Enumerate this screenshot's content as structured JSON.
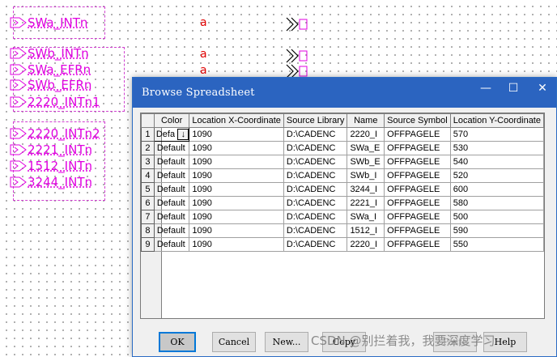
{
  "schematic": {
    "ports": [
      {
        "label": "SWa_INTn"
      },
      {
        "label": "SWb_INTn"
      },
      {
        "label": "SWa_EFRn"
      },
      {
        "label": "SWb_EFRn"
      },
      {
        "label": "2220_INTn1"
      },
      {
        "label": "2220_INTn2"
      },
      {
        "label": "2221_INTn"
      },
      {
        "label": "1512_INTn"
      },
      {
        "label": "3244_INTn"
      }
    ],
    "net_marker": "a"
  },
  "dialog": {
    "title": "Browse Spreadsheet",
    "controls": {
      "minimize": "—",
      "maximize": "☐",
      "close": "✕"
    },
    "columns": [
      "Color",
      "Location X-Coordinate",
      "Source Library",
      "Name",
      "Source Symbol",
      "Location Y-Coordinate"
    ],
    "rows": [
      {
        "num": "1",
        "color": "Defa",
        "x": "1090",
        "lib": "D:\\CADENC",
        "name": "2220_I",
        "symbol": "OFFPAGELE",
        "y": "570"
      },
      {
        "num": "2",
        "color": "Default",
        "x": "1090",
        "lib": "D:\\CADENC",
        "name": "SWa_E",
        "symbol": "OFFPAGELE",
        "y": "530"
      },
      {
        "num": "3",
        "color": "Default",
        "x": "1090",
        "lib": "D:\\CADENC",
        "name": "SWb_E",
        "symbol": "OFFPAGELE",
        "y": "540"
      },
      {
        "num": "4",
        "color": "Default",
        "x": "1090",
        "lib": "D:\\CADENC",
        "name": "SWb_I",
        "symbol": "OFFPAGELE",
        "y": "520"
      },
      {
        "num": "5",
        "color": "Default",
        "x": "1090",
        "lib": "D:\\CADENC",
        "name": "3244_I",
        "symbol": "OFFPAGELE",
        "y": "600"
      },
      {
        "num": "6",
        "color": "Default",
        "x": "1090",
        "lib": "D:\\CADENC",
        "name": "2221_I",
        "symbol": "OFFPAGELE",
        "y": "580"
      },
      {
        "num": "7",
        "color": "Default",
        "x": "1090",
        "lib": "D:\\CADENC",
        "name": "SWa_I",
        "symbol": "OFFPAGELE",
        "y": "500"
      },
      {
        "num": "8",
        "color": "Default",
        "x": "1090",
        "lib": "D:\\CADENC",
        "name": "1512_I",
        "symbol": "OFFPAGELE",
        "y": "590"
      },
      {
        "num": "9",
        "color": "Default",
        "x": "1090",
        "lib": "D:\\CADENC",
        "name": "2220_I",
        "symbol": "OFFPAGELE",
        "y": "550"
      }
    ],
    "buttons": {
      "ok": "OK",
      "cancel": "Cancel",
      "new": "New...",
      "copy": "Copy",
      "paste": "Paste",
      "help": "Help"
    }
  },
  "watermark": "CSDN @别拦着我，我要深度学习"
}
